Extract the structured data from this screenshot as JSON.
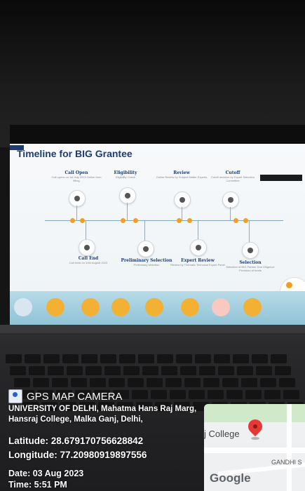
{
  "photo": {
    "screen_title": "Timeline for BIG Grantee",
    "stages_top": [
      {
        "title": "Call Open",
        "sub": "Call opens on 1st July 2023 Online form filling"
      },
      {
        "title": "Eligibility",
        "sub": "Eligibility Check"
      },
      {
        "title": "Review",
        "sub": "Online Review by Subject Matter Experts"
      },
      {
        "title": "Cutoff",
        "sub": "Cutoff decision by Expert Selection Committee"
      }
    ],
    "stages_bottom": [
      {
        "title": "Call End",
        "sub": "Call ends on 10th August 2023"
      },
      {
        "title": "Preliminary Selection",
        "sub": "Preliminary selection"
      },
      {
        "title": "Expert Review",
        "sub": "Review by Thematic Technical Expert Panel"
      },
      {
        "title": "Selection",
        "sub": "Selection of BIG Partner Due Diligence Provision of funds"
      }
    ],
    "nav_colors": [
      "#d9e6ef",
      "#f2b134",
      "#f2b134",
      "#f2b134",
      "#f2b134",
      "#f2b134",
      "#f7c9c0",
      "#f2b134"
    ]
  },
  "overlay": {
    "app_name": "GPS MAP CAMERA",
    "address": "UNIVERSITY OF DELHI, Mahatma Hans Raj Marg, Hansraj College, Malka Ganj, Delhi,",
    "latitude": "Latitude: 28.679170756628842",
    "longitude": "Longitude: 77.20980919897556",
    "date": "Date: 03 Aug 2023",
    "time": "Time: 5:51 PM"
  },
  "map": {
    "place_label": "j College",
    "street_label": "GANDHI S",
    "provider_label": "Google",
    "pin_icon": "map-pin-icon",
    "pin_color": "#e53935"
  }
}
